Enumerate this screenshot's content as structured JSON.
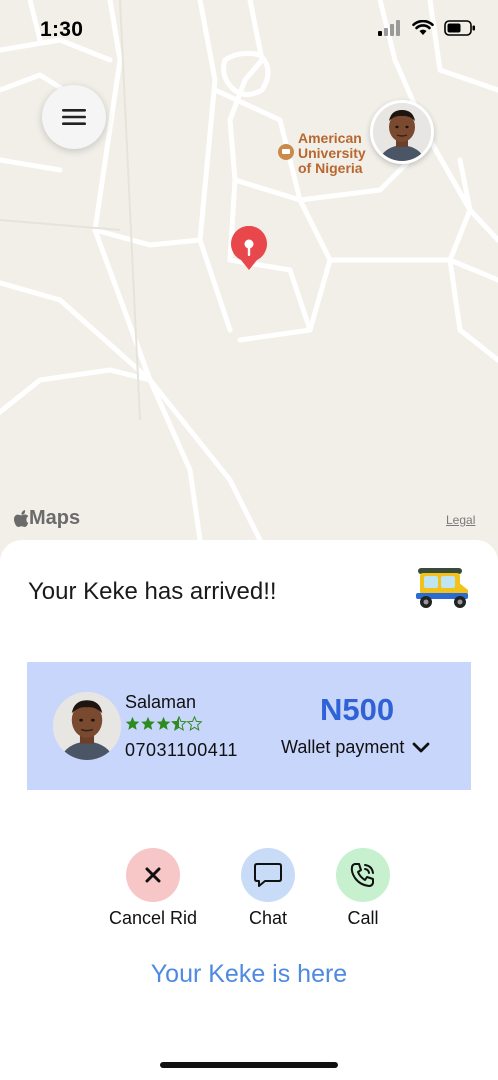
{
  "status_bar": {
    "time": "1:30"
  },
  "map": {
    "poi": {
      "line1": "American",
      "line2": "University",
      "line3": "of Nigeria"
    },
    "logo_text": "Maps",
    "legal": "Legal"
  },
  "sheet": {
    "title": "Your Keke has arrived!!",
    "driver": {
      "name": "Salaman",
      "rating_stars": "★★★⯪☆",
      "rating_value": 3.5,
      "rating_max": 5,
      "phone": "07031100411"
    },
    "fare": "N500",
    "payment_method": "Wallet payment",
    "actions": {
      "cancel": "Cancel Rid",
      "chat": "Chat",
      "call": "Call"
    },
    "status_message": "Your Keke is here"
  },
  "colors": {
    "card_bg": "#c9d6fb",
    "fare": "#2f62d6",
    "cancel_bg": "#f7c6c6",
    "chat_bg": "#c8dcf7",
    "call_bg": "#c7f0cf",
    "link": "#4f8ae0",
    "pin": "#e8474b"
  }
}
